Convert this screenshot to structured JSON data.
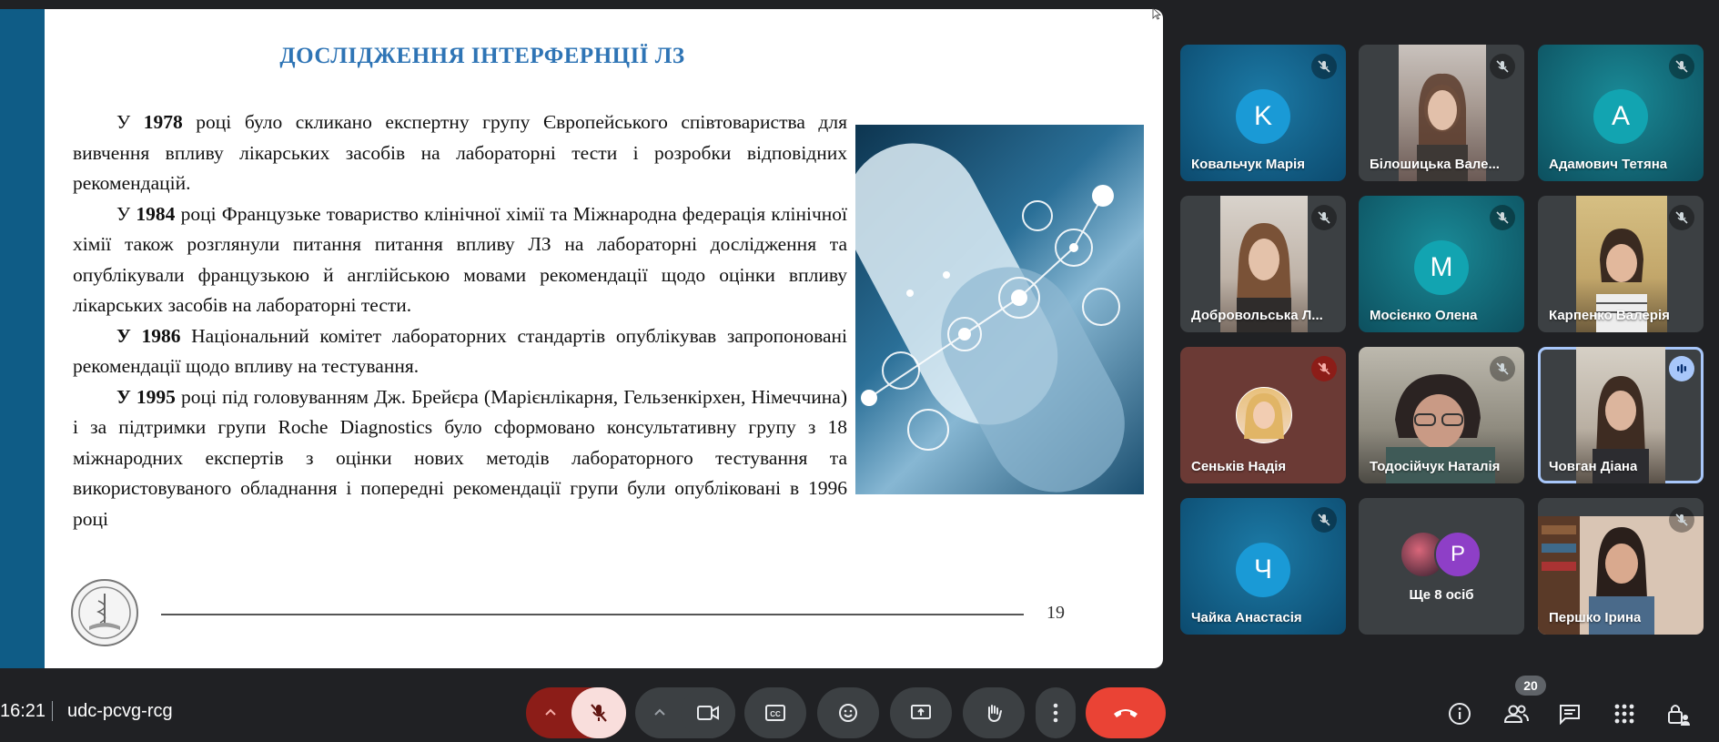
{
  "slide": {
    "title": "ДОСЛІДЖЕННЯ ІНТЕРФЕРНЦІЇ ЛЗ",
    "p1_year": "1978",
    "p1_pre": "У ",
    "p1_text": " році було скликано експертну групу Європейського співтовариства для вивчення впливу лікарських засобів на лабораторні тести і розробки відповідних рекомендацій.",
    "p2_year": "1984",
    "p2_pre": "У ",
    "p2_text": " році Французьке товариство клінічної хімії та Міжнародна федерація клінічної хімії також розглянули  питання питання впливу ЛЗ на лабораторні дослідження та опублікували французькою й англійською мовами рекомендації щодо оцінки впливу лікарських засобів на лабораторні тести.",
    "p3_year": "У 1986",
    "p3_text": " Національний комітет лабораторних стандартів опублікував запропоновані рекомендації щодо  впливу на тестування.",
    "p4_year": "У 1995",
    "p4_text": " році під головуванням Дж. Брейєра (Марієнлікарня, Гельзенкірхен, Німеччина) і за підтримки групи Roche Diagnostics було сформовано консультативну групу з 18 міжнародних експертів з оцінки нових методів лабораторного тестування та використовуваного обладнання і попередні рекомендації групи були опубліковані в 1996 році",
    "page_number": "19"
  },
  "participants": [
    {
      "name": "Ковальчук Марія",
      "initial": "K",
      "type": "avatar",
      "color": "#1a9ad6",
      "muted": true
    },
    {
      "name": "Білошицька Вале...",
      "type": "video",
      "muted": true
    },
    {
      "name": "Адамович Тетяна",
      "initial": "A",
      "type": "avatar",
      "color": "#12a4b1",
      "muted": true
    },
    {
      "name": "Добровольська Л...",
      "type": "video",
      "muted": true
    },
    {
      "name": "Мосієнко Олена",
      "initial": "M",
      "type": "avatar",
      "color": "#12a4b1",
      "muted": true
    },
    {
      "name": "Карпенко Валерія",
      "type": "video",
      "muted": true
    },
    {
      "name": "Сеньків Надія",
      "type": "photo",
      "muted": true
    },
    {
      "name": "Тодосійчук Наталія",
      "type": "video",
      "muted": true
    },
    {
      "name": "Човган Діана",
      "type": "video",
      "speaking": true
    },
    {
      "name": "Чайка Анастасія",
      "initial": "Ч",
      "type": "avatar",
      "color": "#1a9ad6",
      "muted": true
    },
    {
      "name": "Ще 8 осіб",
      "initial": "P",
      "type": "more"
    },
    {
      "name": "Першко Ірина",
      "type": "video",
      "muted": true
    }
  ],
  "bottom": {
    "time": "16:21",
    "meeting_code": "udc-pcvg-rcg",
    "participants_count": "20"
  },
  "colors": {
    "end_call": "#ea4335",
    "mic_off_bg": "#f9dedc",
    "mic_group_bg": "#8c1d18",
    "tile_teal": "#0e5f86"
  }
}
